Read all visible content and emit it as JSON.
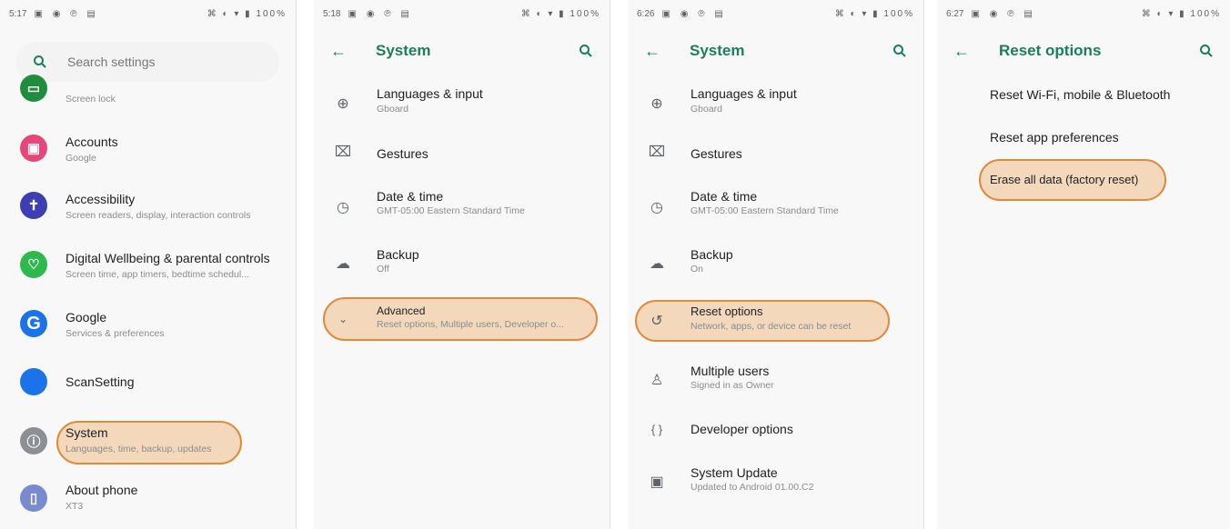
{
  "screens": [
    {
      "status": {
        "time": "5:17",
        "right": "100%"
      },
      "search": {
        "placeholder": "Search settings"
      },
      "items": [
        {
          "label": "",
          "sub": "Screen lock",
          "icon": "lock-icon",
          "color": "#1e8e3e"
        },
        {
          "label": "Accounts",
          "sub": "Google",
          "icon": "account-box-icon",
          "color": "#e8457a"
        },
        {
          "label": "Accessibility",
          "sub": "Screen readers, display, interaction controls",
          "icon": "accessibility-icon",
          "color": "#3d3db4"
        },
        {
          "label": "Digital Wellbeing & parental controls",
          "sub": "Screen time, app timers, bedtime schedul...",
          "icon": "wellbeing-icon",
          "color": "#2eb84e"
        },
        {
          "label": "Google",
          "sub": "Services & preferences",
          "icon": "google-icon",
          "color": "#1a73e8"
        },
        {
          "label": "ScanSetting",
          "sub": "",
          "icon": "scan-icon",
          "color": "#1a73e8"
        },
        {
          "label": "System",
          "sub": "Languages, time, backup, updates",
          "icon": "info-icon",
          "color": "#8c8f93"
        },
        {
          "label": "About phone",
          "sub": "XT3",
          "icon": "phone-icon",
          "color": "#7a8ad1"
        }
      ]
    },
    {
      "status": {
        "time": "5:18",
        "right": "100%"
      },
      "title": "System",
      "items": [
        {
          "label": "Languages & input",
          "sub": "Gboard",
          "icon": "globe-icon"
        },
        {
          "label": "Gestures",
          "sub": "",
          "icon": "gesture-icon"
        },
        {
          "label": "Date & time",
          "sub": "GMT-05:00 Eastern Standard Time",
          "icon": "clock-icon"
        },
        {
          "label": "Backup",
          "sub": "Off",
          "icon": "cloud-backup-icon"
        },
        {
          "label": "Advanced",
          "sub": "Reset options, Multiple users, Developer o...",
          "icon": "chevron-down-icon"
        }
      ]
    },
    {
      "status": {
        "time": "6:26",
        "right": "100%"
      },
      "title": "System",
      "items": [
        {
          "label": "Languages & input",
          "sub": "Gboard",
          "icon": "globe-icon"
        },
        {
          "label": "Gestures",
          "sub": "",
          "icon": "gesture-icon"
        },
        {
          "label": "Date & time",
          "sub": "GMT-05:00 Eastern Standard Time",
          "icon": "clock-icon"
        },
        {
          "label": "Backup",
          "sub": "On",
          "icon": "cloud-backup-icon"
        },
        {
          "label": "Reset options",
          "sub": "Network, apps, or device can be reset",
          "icon": "history-icon"
        },
        {
          "label": "Multiple users",
          "sub": "Signed in as Owner",
          "icon": "person-icon"
        },
        {
          "label": "Developer options",
          "sub": "",
          "icon": "braces-icon"
        },
        {
          "label": "System Update",
          "sub": "Updated to Android 01.00.C2",
          "icon": "system-update-icon"
        }
      ]
    },
    {
      "status": {
        "time": "6:27",
        "right": "100%"
      },
      "title": "Reset options",
      "items": [
        {
          "label": "Reset Wi-Fi, mobile & Bluetooth"
        },
        {
          "label": "Reset app preferences"
        },
        {
          "label": "Erase all data (factory reset)"
        }
      ]
    }
  ],
  "colors": {
    "accent": "#1a7f5a",
    "highlight": "#e08a3c"
  }
}
